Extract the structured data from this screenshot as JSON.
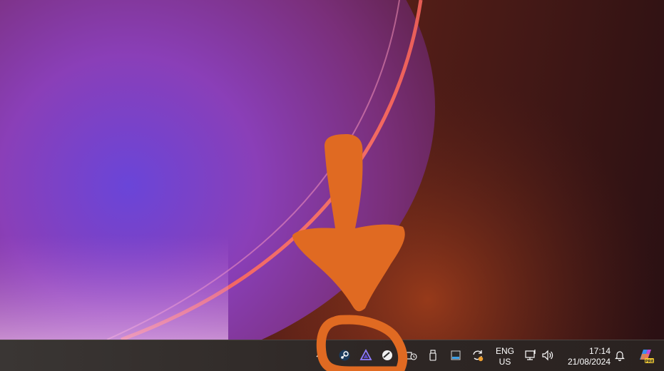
{
  "taskbar": {
    "tray_icons": [
      {
        "name": "chevron-up-icon"
      },
      {
        "name": "steam-icon"
      },
      {
        "name": "proton-vpn-icon"
      },
      {
        "name": "disk-app-icon"
      },
      {
        "name": "network-clock-icon"
      },
      {
        "name": "usb-drive-icon"
      },
      {
        "name": "window-color-icon"
      },
      {
        "name": "update-sync-icon"
      }
    ],
    "language": {
      "line1": "ENG",
      "line2": "US"
    },
    "clock": {
      "time": "17:14",
      "date": "21/08/2024"
    },
    "copilot_badge": "PRE"
  },
  "annotation": {
    "color": "#e06a22"
  },
  "colors": {
    "taskbar_bg": "#2e2725",
    "text": "#ffffff",
    "steam": "#2a8bd4",
    "proton_vpn": "#8f7cff",
    "update_badge": "#f0a030"
  }
}
